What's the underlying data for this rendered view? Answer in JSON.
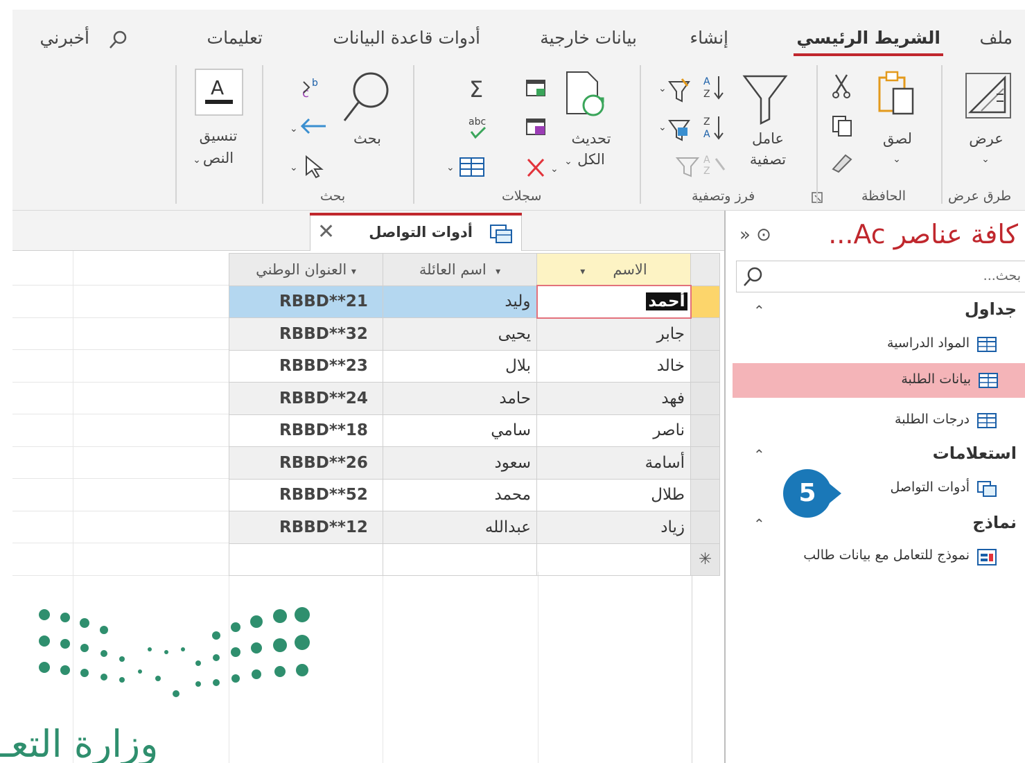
{
  "ribbon": {
    "tabs": {
      "file": "ملف",
      "home": "الشريط الرئيسي",
      "create": "إنشاء",
      "external": "بيانات خارجية",
      "dbtools": "أدوات قاعدة البيانات",
      "help": "تعليمات",
      "tellme": "أخبرني"
    },
    "buttons": {
      "view": "عرض",
      "paste": "لصق",
      "filter_l1": "عامل",
      "filter_l2": "تصفية",
      "refresh_l1": "تحديث",
      "refresh_l2": "الكل",
      "find": "بحث",
      "textfmt_l1": "تنسيق",
      "textfmt_l2": "النص"
    },
    "groups": {
      "views": "طرق عرض",
      "clipboard": "الحافظة",
      "sortfilter": "فرز وتصفية",
      "records": "سجلات",
      "find": "بحث"
    }
  },
  "nav": {
    "title": "كافة عناصر Ac...",
    "controls": "» ⊙",
    "search_placeholder": "بحث...",
    "groups": {
      "tables": "جداول",
      "queries": "استعلامات",
      "forms": "نماذج"
    },
    "items": {
      "subjects": "المواد الدراسية",
      "students": "بيانات الطلبة",
      "grades": "درجات الطلبة",
      "comm_tools": "أدوات التواصل",
      "student_form": "نموذج للتعامل مع بيانات طالب"
    }
  },
  "document": {
    "tab_label": "أدوات التواصل",
    "close": "✕"
  },
  "table": {
    "headers": {
      "name": "الاسم",
      "family": "اسم العائلة",
      "national": "العنوان الوطني"
    },
    "rows": [
      {
        "name": "أحمد",
        "family": "وليد",
        "code": "RBBD**21"
      },
      {
        "name": "جابر",
        "family": "يحيى",
        "code": "RBBD**32"
      },
      {
        "name": "خالد",
        "family": "بلال",
        "code": "RBBD**23"
      },
      {
        "name": "فهد",
        "family": "حامد",
        "code": "RBBD**24"
      },
      {
        "name": "ناصر",
        "family": "سامي",
        "code": "RBBD**18"
      },
      {
        "name": "أسامة",
        "family": "سعود",
        "code": "RBBD**26"
      },
      {
        "name": "طلال",
        "family": "محمد",
        "code": "RBBD**52"
      },
      {
        "name": "زياد",
        "family": "عبدالله",
        "code": "RBBD**12"
      }
    ],
    "new_row_marker": "✳"
  },
  "callout": {
    "number": "5"
  },
  "logo": {
    "text": "وزارة التعـ"
  },
  "colors": {
    "accent": "#c0272d",
    "callout": "#1a78b8",
    "logo_green": "#2f8f6e",
    "selected_nav": "#f4b4b8"
  }
}
